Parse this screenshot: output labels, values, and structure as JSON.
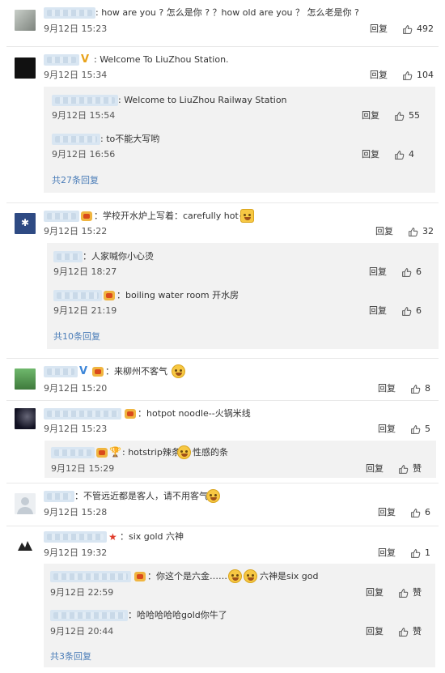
{
  "comments": [
    {
      "text": ": how are you ? 怎么是你 ? ？how old are you ？ 怎么老是你 ?",
      "time": "9月12日 15:23",
      "reply_label": "回复",
      "likes": "492"
    },
    {
      "text": ": Welcome To LiuZhou Station.",
      "time": "9月12日 15:34",
      "reply_label": "回复",
      "likes": "104",
      "replies": [
        {
          "text": ": Welcome to LiuZhou Railway Station",
          "time": "9月12日 15:54",
          "reply_label": "回复",
          "likes": "55"
        },
        {
          "text": ": to不能大写哟",
          "time": "9月12日 16:56",
          "reply_label": "回复",
          "likes": "4"
        }
      ],
      "more": "共27条回复"
    },
    {
      "text": "：学校开水炉上写着：carefully hot~",
      "time": "9月12日 15:22",
      "reply_label": "回复",
      "likes": "32",
      "replies": [
        {
          "text": "：人家喊你小心烫",
          "time": "9月12日 18:27",
          "reply_label": "回复",
          "likes": "6"
        },
        {
          "text": "：boiling water room 开水房",
          "time": "9月12日 21:19",
          "reply_label": "回复",
          "likes": "6"
        }
      ],
      "more": "共10条回复"
    },
    {
      "text": "：来柳州不客气",
      "time": "9月12日 15:20",
      "reply_label": "回复",
      "likes": "8"
    },
    {
      "text": "：hotpot noodle--火锅米线",
      "time": "9月12日 15:23",
      "reply_label": "回复",
      "likes": "5",
      "replies": [
        {
          "text": ": hotstrip辣条",
          "text2": "性感的条",
          "time": "9月12日 15:29",
          "reply_label": "回复",
          "likes": "赞"
        }
      ]
    },
    {
      "text": "：不管远近都是客人，请不用客气",
      "time": "9月12日 15:28",
      "reply_label": "回复",
      "likes": "6"
    },
    {
      "text": "：six gold 六神",
      "time": "9月12日 19:32",
      "reply_label": "回复",
      "likes": "1",
      "replies": [
        {
          "text": "：你这个是六金……",
          "text2": "六神是six god",
          "time": "9月12日 22:59",
          "reply_label": "回复",
          "likes": "赞"
        },
        {
          "text": "：哈哈哈哈哈gold你牛了",
          "time": "9月12日 20:44",
          "reply_label": "回复",
          "likes": "赞"
        }
      ],
      "more": "共3条回复"
    }
  ],
  "colors": {
    "link": "#4b7db8",
    "reply_bg": "#f2f2f2",
    "divider": "#e8e8e8"
  }
}
